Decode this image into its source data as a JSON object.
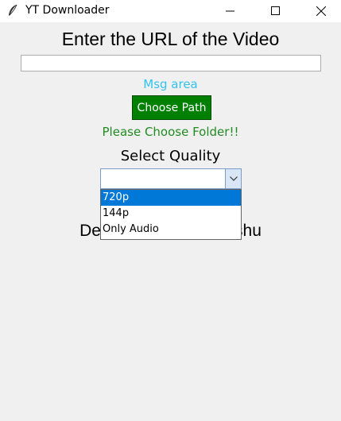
{
  "window": {
    "title": "YT Downloader",
    "icon": "feather-icon"
  },
  "form": {
    "url_heading": "Enter the URL of the Video",
    "url_value": "",
    "msg_area": "Msg area",
    "choose_path_label": "Choose Path",
    "folder_message": "Please Choose Folder!!",
    "quality_label": "Select Quality",
    "quality_value": "",
    "quality_options": [
      "720p",
      "144p",
      "Only Audio"
    ],
    "highlighted_option": "720p",
    "developer_text": "Developed by Himanshu"
  },
  "colors": {
    "msg_area": "#33c3f0",
    "button_bg": "#008000",
    "folder_message": "#228b22",
    "selected_option": "#0078d7"
  }
}
